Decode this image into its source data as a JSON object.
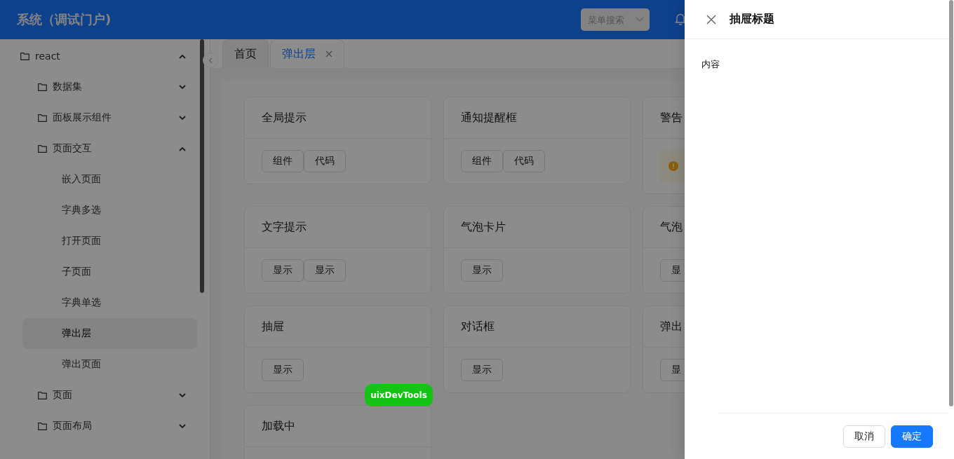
{
  "header": {
    "title": "系统（调试门户)",
    "search": {
      "placeholder": "菜单搜索"
    }
  },
  "sidebar": {
    "items": [
      {
        "kind": "folder",
        "label": "react",
        "expanded": true,
        "children": [
          {
            "kind": "folder",
            "label": "数据集",
            "expanded": false
          },
          {
            "kind": "folder",
            "label": "面板展示组件",
            "expanded": false
          },
          {
            "kind": "folder",
            "label": "页面交互",
            "expanded": true,
            "children": [
              {
                "kind": "page",
                "label": "嵌入页面",
                "selected": false
              },
              {
                "kind": "page",
                "label": "字典多选",
                "selected": false
              },
              {
                "kind": "page",
                "label": "打开页面",
                "selected": false
              },
              {
                "kind": "page",
                "label": "子页面",
                "selected": false
              },
              {
                "kind": "page",
                "label": "字典单选",
                "selected": false
              },
              {
                "kind": "page",
                "label": "弹出层",
                "selected": true
              },
              {
                "kind": "page",
                "label": "弹出页面",
                "selected": false
              }
            ]
          },
          {
            "kind": "folder",
            "label": "页面",
            "expanded": false
          },
          {
            "kind": "folder",
            "label": "页面布局",
            "expanded": false
          }
        ]
      }
    ]
  },
  "tabs": [
    {
      "label": "首页",
      "selected": false,
      "closable": false
    },
    {
      "label": "弹出层",
      "selected": true,
      "closable": true
    }
  ],
  "cards": [
    {
      "title": "全局提示",
      "kind": "buttons",
      "buttons": [
        "组件",
        "代码"
      ]
    },
    {
      "title": "通知提醒框",
      "kind": "buttons",
      "buttons": [
        "组件",
        "代码"
      ]
    },
    {
      "title": "警告",
      "kind": "alert"
    },
    {
      "title": "文字提示",
      "kind": "buttons",
      "buttons": [
        "显示",
        "显示"
      ]
    },
    {
      "title": "气泡卡片",
      "kind": "buttons",
      "buttons": [
        "显示"
      ]
    },
    {
      "title": "气泡",
      "kind": "buttons",
      "buttons": [
        "显"
      ]
    },
    {
      "title": "抽屉",
      "kind": "buttons",
      "buttons": [
        "显示"
      ]
    },
    {
      "title": "对话框",
      "kind": "buttons",
      "buttons": [
        "显示"
      ]
    },
    {
      "title": "弹出",
      "kind": "buttons",
      "buttons": [
        "显"
      ]
    },
    {
      "title": "加载中",
      "kind": "buttons"
    }
  ],
  "devtools_badge": "uixDevTools",
  "drawer": {
    "title": "抽屉标题",
    "content": "内容",
    "buttons": [
      {
        "label": "取消",
        "kind": "default"
      },
      {
        "label": "确定",
        "kind": "primary"
      }
    ]
  }
}
